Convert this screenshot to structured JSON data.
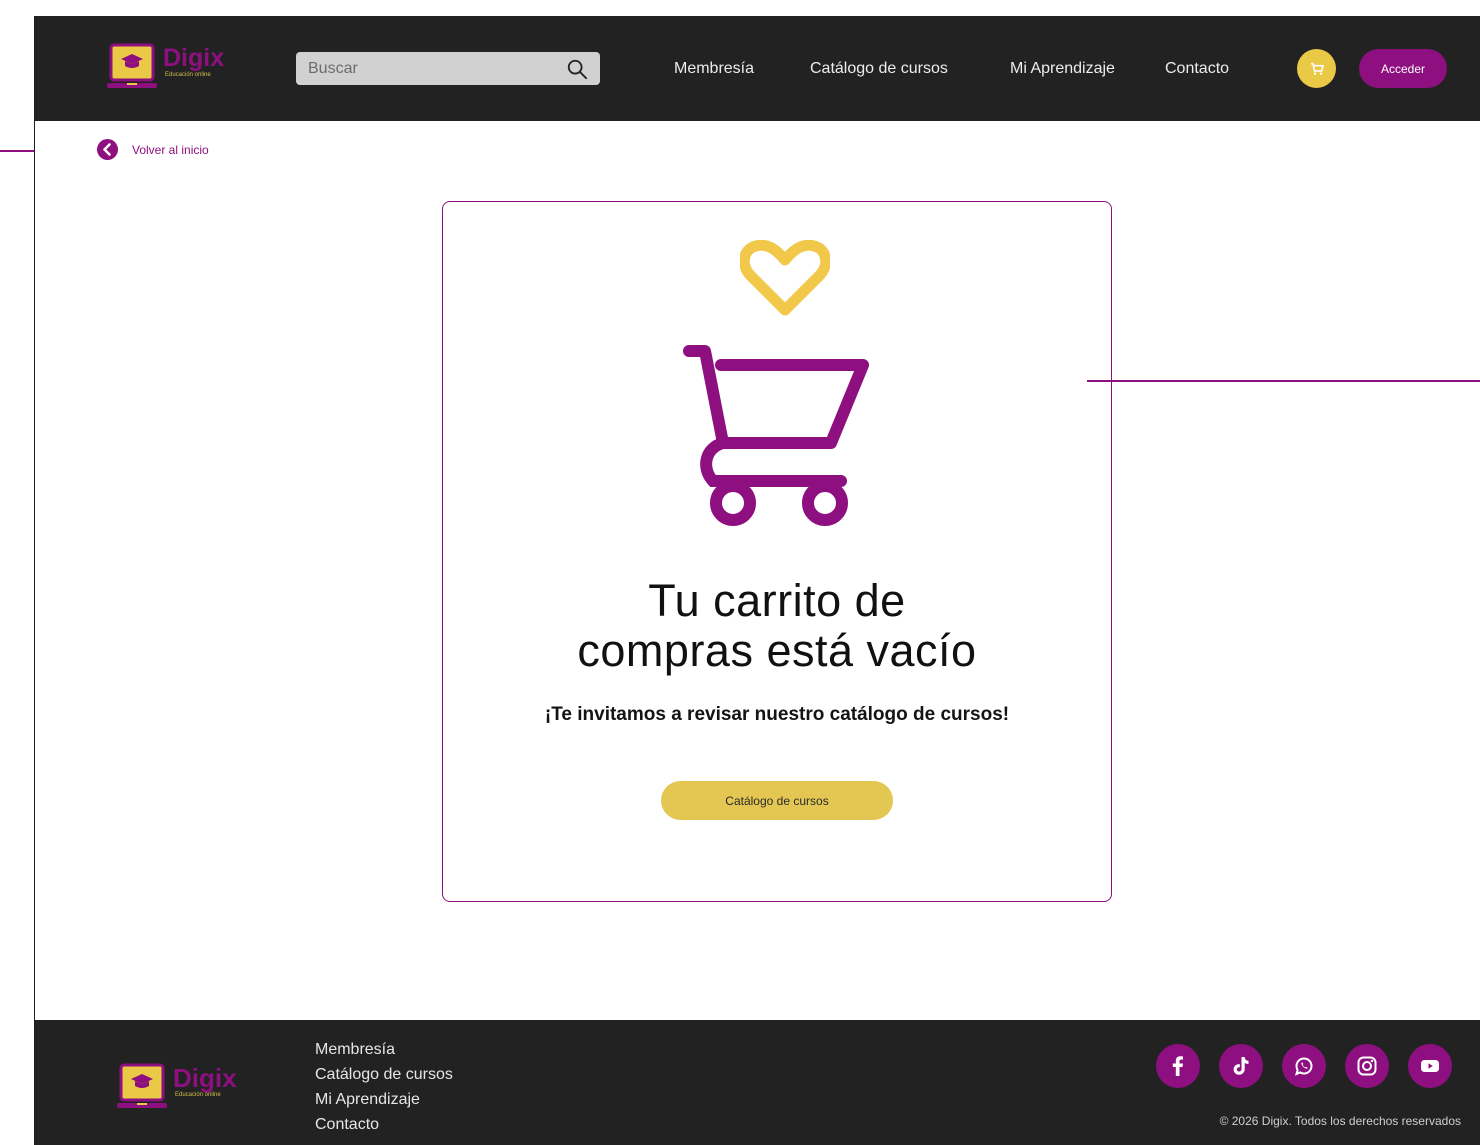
{
  "brand": {
    "name": "Digix",
    "tagline": "Educación online"
  },
  "header": {
    "search_placeholder": "Buscar",
    "nav": [
      "Membresía",
      "Catálogo de cursos",
      "Mi Aprendizaje",
      "Contacto"
    ],
    "login_label": "Acceder"
  },
  "back_link": {
    "label": "Volver al inicio"
  },
  "empty_cart": {
    "title_line1": "Tu carrito de",
    "title_line2": "compras está vacío",
    "message": "¡Te invitamos a revisar nuestro catálogo de cursos!",
    "button_label": "Catálogo de cursos"
  },
  "footer": {
    "links": [
      "Membresía",
      "Catálogo de cursos",
      "Mi Aprendizaje",
      "Contacto"
    ],
    "socials": [
      "facebook-icon",
      "tiktok-icon",
      "whatsapp-icon",
      "instagram-icon",
      "youtube-icon"
    ],
    "copyright": "© 2026 Digix. Todos los derechos reservados"
  },
  "colors": {
    "primary": "#8e0f7f",
    "accent": "#e9c946",
    "dark": "#232222"
  }
}
